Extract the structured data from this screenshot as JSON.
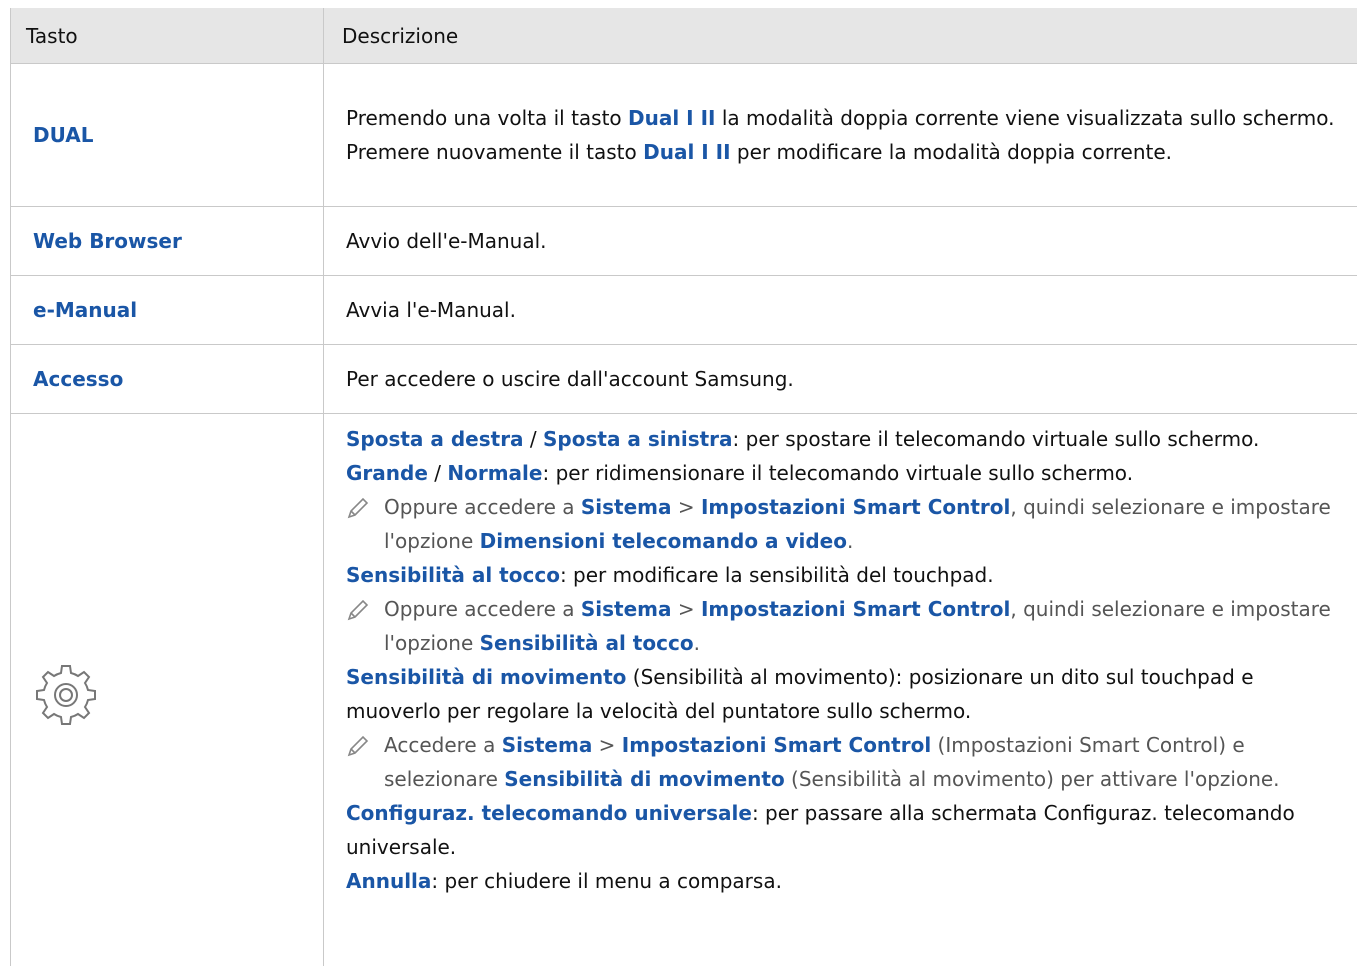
{
  "header": {
    "col_key": "Tasto",
    "col_desc": "Descrizione"
  },
  "rows": {
    "dual": {
      "key": "DUAL",
      "l1a": "Premendo una volta il tasto ",
      "l1b": "Dual I II",
      "l1c": " la modalità doppia corrente viene visualizzata sullo schermo.",
      "l2a": "Premere nuovamente il tasto ",
      "l2b": "Dual I II",
      "l2c": " per modificare la modalità doppia corrente."
    },
    "web": {
      "key": "Web Browser",
      "desc": "Avvio dell'e-Manual."
    },
    "manual": {
      "key": "e-Manual",
      "desc": "Avvia l'e-Manual."
    },
    "access": {
      "key": "Accesso",
      "desc": "Per accedere o uscire dall'account Samsung."
    },
    "gear": {
      "icon": "gear-icon",
      "p1a": "Sposta a destra",
      "p1b": " / ",
      "p1c": "Sposta a sinistra",
      "p1d": ": per spostare il telecomando virtuale sullo schermo.",
      "p2a": "Grande",
      "p2b": " / ",
      "p2c": "Normale",
      "p2d": ": per ridimensionare il telecomando virtuale sullo schermo.",
      "n1a": "Oppure accedere a ",
      "n1b": "Sistema",
      "n1c": " > ",
      "n1d": "Impostazioni Smart Control",
      "n1e": ", quindi selezionare e impostare l'opzione ",
      "n1f": "Dimensioni telecomando a video",
      "n1g": ".",
      "p3a": "Sensibilità al tocco",
      "p3b": ": per modificare la sensibilità del touchpad.",
      "n2a": "Oppure accedere a ",
      "n2b": "Sistema",
      "n2c": " > ",
      "n2d": "Impostazioni Smart Control",
      "n2e": ", quindi selezionare e impostare l'opzione ",
      "n2f": "Sensibilità al tocco",
      "n2g": ".",
      "p4a": "Sensibilità di movimento",
      "p4b": " (Sensibilità al movimento): posizionare un dito sul touchpad e muoverlo per regolare la velocità del puntatore sullo schermo.",
      "n3a": "Accedere a ",
      "n3b": "Sistema",
      "n3c": " > ",
      "n3d": "Impostazioni Smart Control",
      "n3e": " (Impostazioni Smart Control) e selezionare ",
      "n3f": "Sensibilità di movimento",
      "n3g": " (Sensibilità al movimento) per attivare l'opzione.",
      "p5a": "Configuraz. telecomando universale",
      "p5b": ": per passare alla schermata Configuraz. telecomando universale.",
      "p6a": "Annulla",
      "p6b": ": per chiudere il menu a comparsa."
    }
  },
  "colors": {
    "link": "#1a56a6",
    "header_bg": "#e6e6e6",
    "note_text": "#555555",
    "border": "#c9c9c9"
  }
}
